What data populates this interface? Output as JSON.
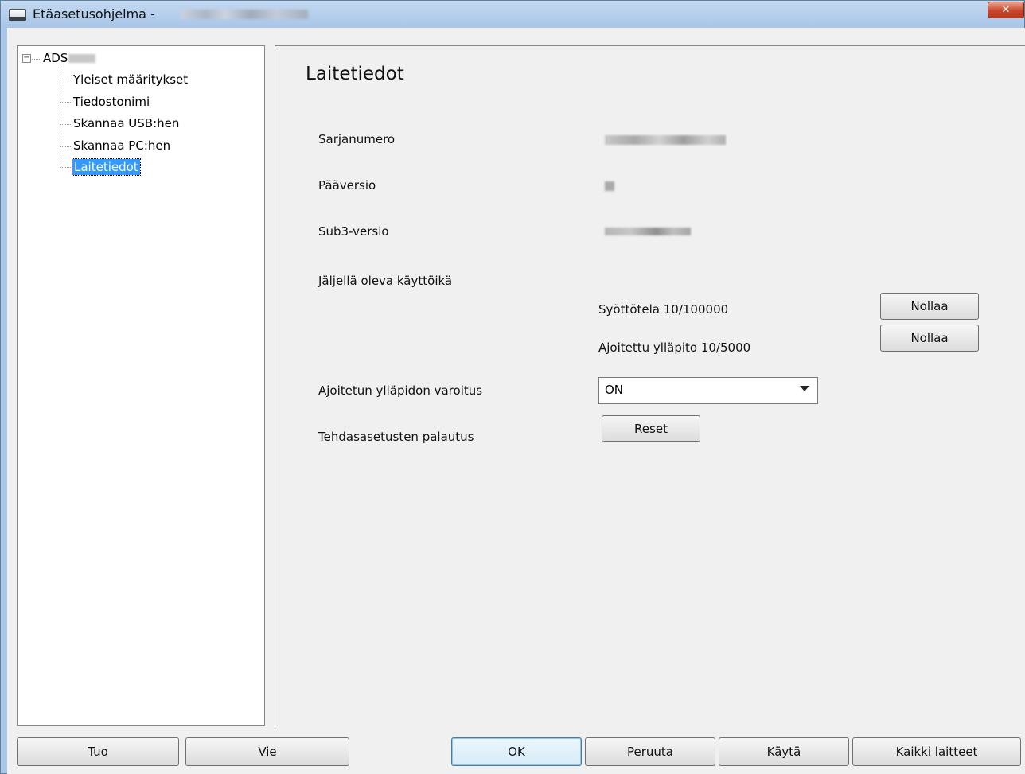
{
  "window": {
    "title": "Etäasetusohjelma -",
    "close_label": "✕"
  },
  "tree": {
    "root_label": "ADS",
    "expander_symbol": "−",
    "items": [
      {
        "label": "Yleiset määritykset"
      },
      {
        "label": "Tiedostonimi"
      },
      {
        "label": "Skannaa USB:hen"
      },
      {
        "label": "Skannaa PC:hen"
      },
      {
        "label": "Laitetiedot",
        "selected": true
      }
    ]
  },
  "panel": {
    "title": "Laitetiedot",
    "serial_label": "Sarjanumero",
    "main_version_label": "Pääversio",
    "sub3_version_label": "Sub3-versio",
    "remaining_life_label": "Jäljellä oleva käyttöikä",
    "feed_roller": {
      "label": "Syöttötela 10/100000",
      "button": "Nollaa"
    },
    "scheduled_maintenance": {
      "label": "Ajoitettu ylläpito 10/5000",
      "button": "Nollaa"
    },
    "maintenance_warning": {
      "label": "Ajoitetun ylläpidon varoitus",
      "value": "ON"
    },
    "factory_reset": {
      "label": "Tehdasasetusten palautus",
      "button": "Reset"
    }
  },
  "footer": {
    "import": "Tuo",
    "export": "Vie",
    "ok": "OK",
    "cancel": "Peruuta",
    "apply": "Käytä",
    "all_devices": "Kaikki laitteet"
  },
  "colors": {
    "titlebar": "#a8c5e8",
    "selection": "#3399ff",
    "close": "#c9462c",
    "dialog_bg": "#f0f0f0"
  }
}
